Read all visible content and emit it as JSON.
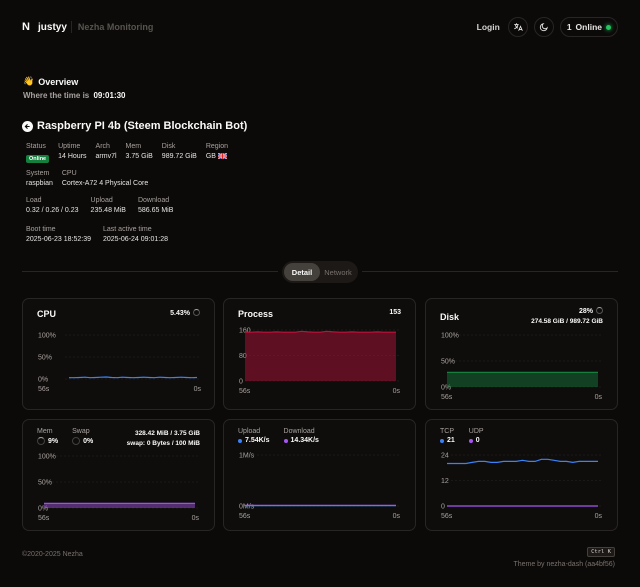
{
  "header": {
    "logo_mark": "N",
    "brand": "justyy",
    "subtitle": "Nezha Monitoring",
    "login_label": "Login",
    "online_count": "1",
    "online_label": "Online"
  },
  "overview": {
    "emoji": "👋",
    "title": "Overview",
    "time_label": "Where the time is",
    "time_value": "09:01:30"
  },
  "server": {
    "name": "Raspberry PI 4b (Steem Blockchain Bot)",
    "row1": [
      {
        "label": "Status",
        "value": "Online"
      },
      {
        "label": "Uptime",
        "value": "14 Hours"
      },
      {
        "label": "Arch",
        "value": "armv7l"
      },
      {
        "label": "Mem",
        "value": "3.75 GiB"
      },
      {
        "label": "Disk",
        "value": "989.72 GiB"
      },
      {
        "label": "Region",
        "value": "GB"
      }
    ],
    "row2": [
      {
        "label": "System",
        "value": "raspbian"
      },
      {
        "label": "CPU",
        "value": "Cortex-A72 4 Physical Core"
      }
    ],
    "row3": [
      {
        "label": "Load",
        "value": "0.32 / 0.26 / 0.23"
      },
      {
        "label": "Upload",
        "value": "235.48 MiB"
      },
      {
        "label": "Download",
        "value": "586.65 MiB"
      }
    ],
    "row4": [
      {
        "label": "Boot time",
        "value": "2025-06-23 18:52:39"
      },
      {
        "label": "Last active time",
        "value": "2025-06-24 09:01:28"
      }
    ]
  },
  "tabs": [
    {
      "label": "Detail",
      "active": true
    },
    {
      "label": "Network",
      "active": false
    }
  ],
  "colors": {
    "cpu": "#3b82f6",
    "process": "#be123c",
    "disk": "#15803d",
    "mem": "#a855f7",
    "upload": "#3b82f6",
    "download": "#a855f7",
    "online": "#22c55e"
  },
  "cards": {
    "cpu": {
      "title": "CPU",
      "value": "5.43%",
      "y_ticks": [
        "100%",
        "50%",
        "0%"
      ],
      "x_start": "56s",
      "x_end": "0s"
    },
    "process": {
      "title": "Process",
      "value": "153",
      "y_ticks": [
        "160",
        "80",
        "0"
      ],
      "x_start": "56s",
      "x_end": "0s"
    },
    "disk": {
      "title": "Disk",
      "value": "28%",
      "detail": "274.58 GiB / 989.72 GiB",
      "y_ticks": [
        "100%",
        "50%",
        "0%"
      ],
      "x_start": "56s",
      "x_end": "0s"
    },
    "memory": {
      "mem_label": "Mem",
      "mem_value": "9%",
      "swap_label": "Swap",
      "swap_value": "0%",
      "mem_detail": "328.42 MiB / 3.75 GiB",
      "swap_detail": "swap: 0 Bytes / 100 MiB",
      "y_ticks": [
        "100%",
        "50%",
        "0%"
      ],
      "x_start": "56s",
      "x_end": "0s"
    },
    "network": {
      "upload_label": "Upload",
      "upload_value": "7.54K/s",
      "download_label": "Download",
      "download_value": "14.34K/s",
      "y_ticks": [
        "1M/s",
        "0M/s"
      ],
      "x_start": "56s",
      "x_end": "0s"
    },
    "connections": {
      "tcp_label": "TCP",
      "tcp_value": "21",
      "udp_label": "UDP",
      "udp_value": "0",
      "y_ticks": [
        "24",
        "12",
        "0"
      ],
      "x_start": "56s",
      "x_end": "0s"
    }
  },
  "chart_data": [
    {
      "type": "line",
      "name": "cpu",
      "ylim": [
        0,
        100
      ],
      "values": [
        3,
        3,
        3.5,
        4,
        3,
        3.5,
        4,
        4.5,
        3.5,
        3,
        4,
        3.5,
        3,
        3.5,
        4,
        3.5,
        3,
        4,
        3.5,
        3,
        3.5,
        4,
        3.5,
        3,
        3.5
      ]
    },
    {
      "type": "area",
      "name": "process",
      "ylim": [
        0,
        160
      ],
      "values": [
        153,
        153,
        154,
        153,
        153,
        154,
        153,
        153,
        153,
        156,
        154,
        153,
        153,
        156,
        154,
        153,
        153,
        154,
        153,
        153,
        153,
        154,
        153,
        153,
        153
      ]
    },
    {
      "type": "area",
      "name": "disk",
      "ylim": [
        0,
        100
      ],
      "values": [
        28,
        28,
        28,
        28,
        28,
        28,
        28,
        28,
        28,
        28,
        28,
        28,
        28,
        28,
        28,
        28,
        28,
        28,
        28,
        28,
        28,
        28,
        28,
        28,
        28
      ]
    },
    {
      "type": "area",
      "name": "memory",
      "ylim": [
        0,
        100
      ],
      "values": [
        9,
        9,
        9,
        9,
        9,
        9,
        9,
        9,
        9,
        9,
        9,
        9,
        9,
        9,
        9,
        9,
        9,
        9,
        9,
        9,
        9,
        9,
        9,
        9,
        9
      ]
    },
    {
      "type": "line",
      "name": "network",
      "ylim": [
        0,
        1000
      ],
      "series": [
        {
          "name": "Upload",
          "values": [
            7.5,
            7.5,
            7.5,
            7.5,
            7.5,
            7.5,
            7.5,
            7.5,
            7.5,
            7.5,
            7.5,
            7.5,
            7.5,
            7.5,
            7.5,
            7.5,
            7.5,
            7.5,
            7.5,
            7.5,
            7.5,
            7.5,
            7.5,
            7.5,
            7.5
          ]
        },
        {
          "name": "Download",
          "values": [
            14,
            14,
            14,
            14,
            14,
            14,
            14,
            14,
            14,
            14,
            14,
            14,
            14,
            14,
            14,
            14,
            14,
            14,
            14,
            14,
            14,
            14,
            14,
            14,
            14
          ]
        }
      ]
    },
    {
      "type": "line",
      "name": "connections",
      "ylim": [
        0,
        24
      ],
      "series": [
        {
          "name": "TCP",
          "values": [
            20,
            20,
            20,
            20,
            20.5,
            21,
            21,
            20.5,
            20.5,
            21,
            21,
            21,
            21.5,
            21,
            21,
            22,
            22,
            21.5,
            21,
            21,
            20.5,
            21,
            21,
            21,
            21
          ]
        },
        {
          "name": "UDP",
          "values": [
            0,
            0,
            0,
            0,
            0,
            0,
            0,
            0,
            0,
            0,
            0,
            0,
            0,
            0,
            0,
            0,
            0,
            0,
            0,
            0,
            0,
            0,
            0,
            0,
            0
          ]
        }
      ]
    }
  ],
  "footer": {
    "copyright": "©2020-2025 Nezha",
    "kbd": "Ctrl K",
    "theme": "Theme by nezha-dash (aa4bf56)"
  }
}
